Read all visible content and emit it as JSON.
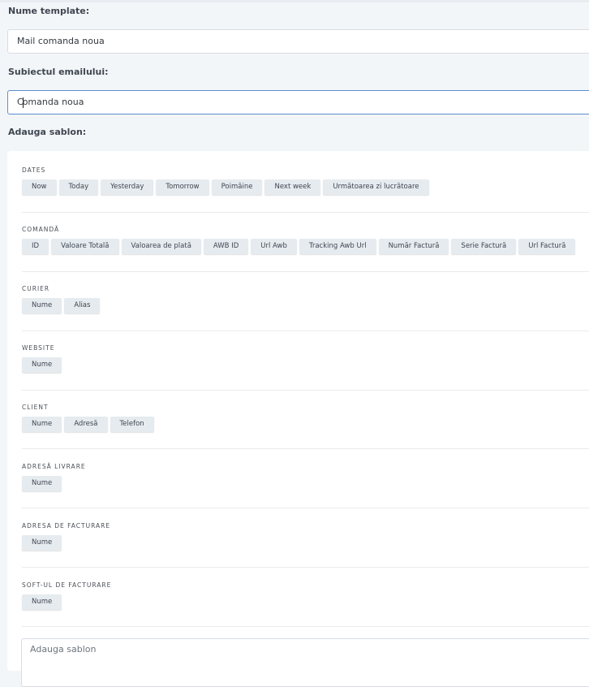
{
  "form": {
    "template_name_label": "Nume template:",
    "template_name_value": "Mail comanda noua",
    "subject_label": "Subiectul emailului:",
    "subject_value_before_caret": "C",
    "subject_value_after_caret": "omanda noua",
    "add_template_label": "Adauga sablon:",
    "template_textarea_placeholder": "Adauga sablon"
  },
  "sections": [
    {
      "title": "DATES",
      "chips": [
        "Now",
        "Today",
        "Yesterday",
        "Tomorrow",
        "Poimâine",
        "Next week",
        "Următoarea zi lucrătoare"
      ]
    },
    {
      "title": "COMANDĂ",
      "chips": [
        "ID",
        "Valoare Totală",
        "Valoarea de plată",
        "AWB ID",
        "Url Awb",
        "Tracking Awb Url",
        "Număr Factură",
        "Serie Factură",
        "Url Factură"
      ]
    },
    {
      "title": "CURIER",
      "chips": [
        "Nume",
        "Alias"
      ]
    },
    {
      "title": "WEBSITE",
      "chips": [
        "Nume"
      ]
    },
    {
      "title": "CLIENT",
      "chips": [
        "Nume",
        "Adresă",
        "Telefon"
      ]
    },
    {
      "title": "ADRESĂ LIVRARE",
      "chips": [
        "Nume"
      ]
    },
    {
      "title": "ADRESA DE FACTURARE",
      "chips": [
        "Nume"
      ]
    },
    {
      "title": "SOFT-UL DE FACTURARE",
      "chips": [
        "Nume"
      ]
    }
  ]
}
